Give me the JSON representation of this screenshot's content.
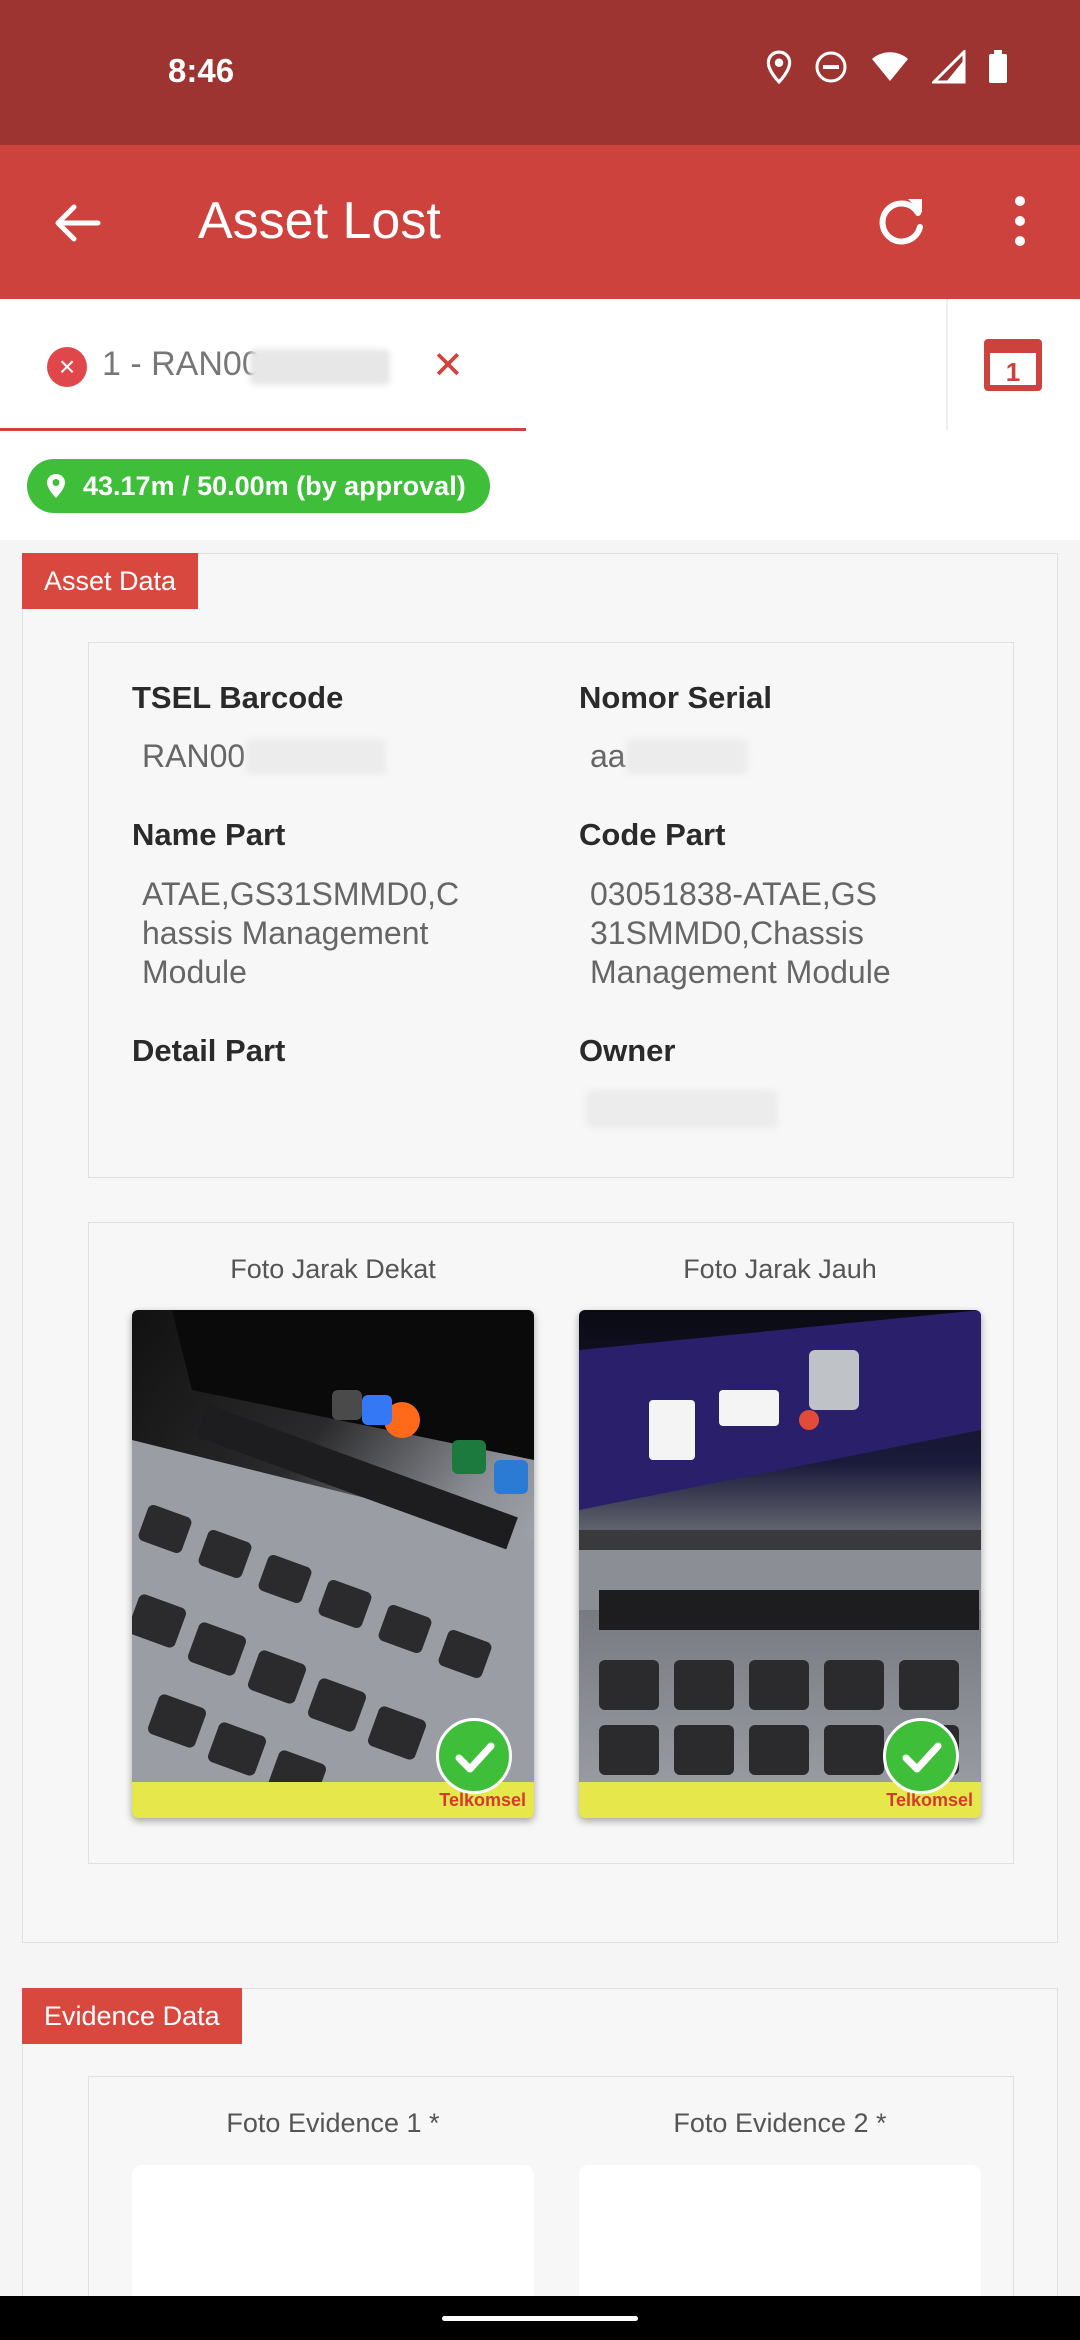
{
  "status": {
    "time": "8:46"
  },
  "appbar": {
    "title": "Asset Lost"
  },
  "tab": {
    "label": "1 - RAN00",
    "calendar_number": "1"
  },
  "distance_badge": {
    "text": "43.17m / 50.00m (by approval)"
  },
  "asset_section": {
    "label": "Asset Data",
    "fields": {
      "tsel_barcode": {
        "label": "TSEL Barcode",
        "value": "RAN00"
      },
      "nomor_serial": {
        "label": "Nomor Serial",
        "value": "aa"
      },
      "name_part": {
        "label": "Name Part",
        "value_lines": [
          "ATAE,GS31SMMD0,C",
          "hassis Management",
          "Module"
        ]
      },
      "code_part": {
        "label": "Code Part",
        "value_lines": [
          "03051838-ATAE,GS",
          "31SMMD0,Chassis",
          "Management Module"
        ]
      },
      "detail_part": {
        "label": "Detail Part",
        "value": ""
      },
      "owner": {
        "label": "Owner",
        "value": ""
      }
    },
    "photos": {
      "near": {
        "caption": "Foto Jarak Dekat",
        "brand": "Telkomsel"
      },
      "far": {
        "caption": "Foto Jarak Jauh",
        "brand": "Telkomsel"
      }
    }
  },
  "evidence_section": {
    "label": "Evidence Data",
    "photo1_caption": "Foto Evidence 1 *",
    "photo2_caption": "Foto Evidence 2 *"
  },
  "colors": {
    "primary": "#cd423d",
    "status_bar": "#9e3431",
    "success": "#3fbe3a"
  },
  "icons": [
    "location-icon",
    "dnd-icon",
    "wifi-icon",
    "signal-icon",
    "battery-icon",
    "back-arrow-icon",
    "refresh-icon",
    "more-vert-icon",
    "calendar-icon",
    "check-icon"
  ]
}
